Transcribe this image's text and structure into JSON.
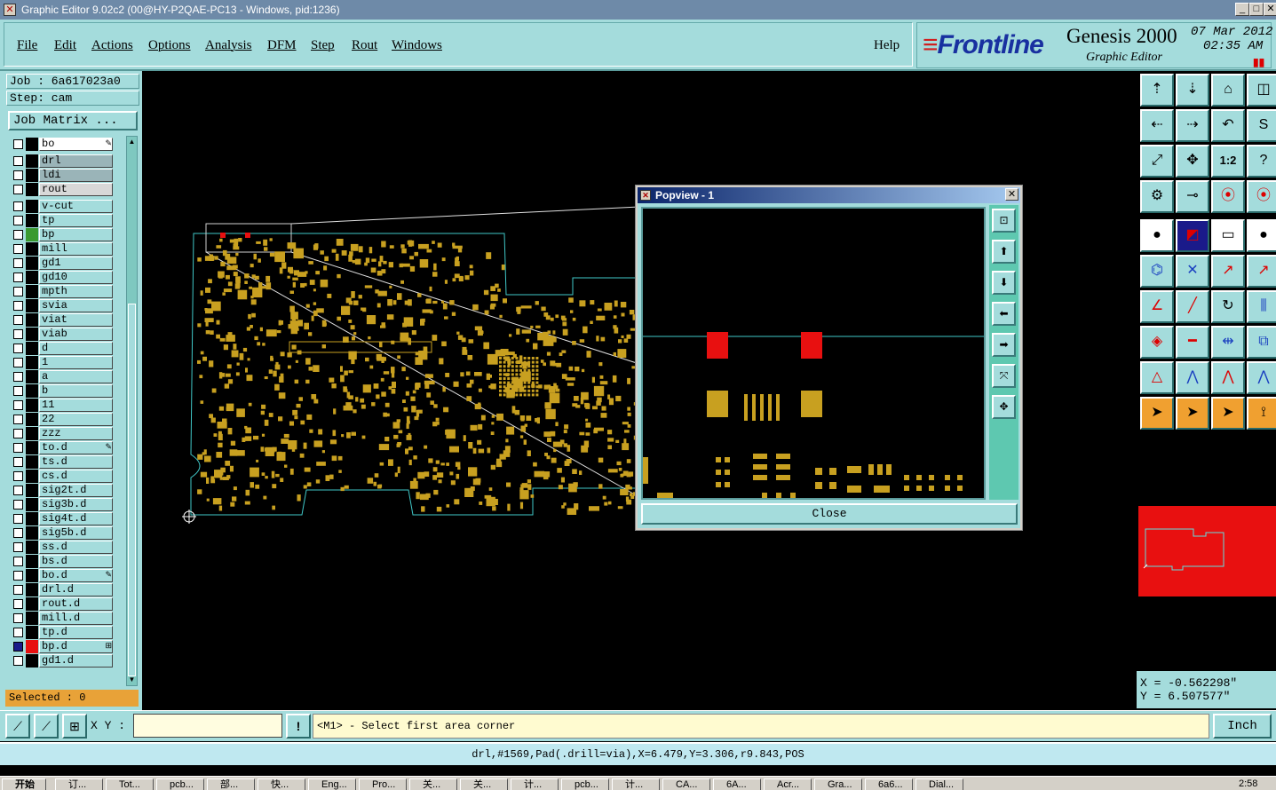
{
  "window": {
    "title": "Graphic Editor 9.02c2 (00@HY-P2QAE-PC13 - Windows, pid:1236)"
  },
  "menu": {
    "items": [
      "File",
      "Edit",
      "Actions",
      "Options",
      "Analysis",
      "DFM",
      "Step",
      "Rout",
      "Windows"
    ],
    "help": "Help"
  },
  "brand": {
    "logo": "Frontline",
    "product": "Genesis 2000",
    "subtitle": "Graphic Editor",
    "date": "07 Mar 2012",
    "time": "02:35 AM"
  },
  "job": {
    "job_label": "Job : 6a617023a0",
    "step_label": "Step: cam",
    "matrix_button": "Job Matrix ..."
  },
  "layers": [
    {
      "name": "bo",
      "color": "#000000",
      "mark": "✎",
      "style": "white"
    },
    {
      "name": "drl",
      "color": "#000000",
      "mark": "",
      "style": "grey"
    },
    {
      "name": "ldi",
      "color": "#000000",
      "mark": "",
      "style": "grey"
    },
    {
      "name": "rout",
      "color": "#000000",
      "mark": "",
      "style": "lightgrey"
    },
    {
      "name": "v-cut",
      "color": "#000000",
      "mark": "",
      "style": "normal"
    },
    {
      "name": "tp",
      "color": "#000000",
      "mark": "",
      "style": "normal"
    },
    {
      "name": "bp",
      "color": "#3a9a30",
      "mark": "",
      "style": "normal"
    },
    {
      "name": "mill",
      "color": "#000000",
      "mark": "",
      "style": "normal"
    },
    {
      "name": "gd1",
      "color": "#000000",
      "mark": "",
      "style": "normal"
    },
    {
      "name": "gd10",
      "color": "#000000",
      "mark": "",
      "style": "normal"
    },
    {
      "name": "mpth",
      "color": "#000000",
      "mark": "",
      "style": "normal"
    },
    {
      "name": "svia",
      "color": "#000000",
      "mark": "",
      "style": "normal"
    },
    {
      "name": "viat",
      "color": "#000000",
      "mark": "",
      "style": "normal"
    },
    {
      "name": "viab",
      "color": "#000000",
      "mark": "",
      "style": "normal"
    },
    {
      "name": "d",
      "color": "#000000",
      "mark": "",
      "style": "normal"
    },
    {
      "name": "1",
      "color": "#000000",
      "mark": "",
      "style": "normal"
    },
    {
      "name": "a",
      "color": "#000000",
      "mark": "",
      "style": "normal"
    },
    {
      "name": "b",
      "color": "#000000",
      "mark": "",
      "style": "normal"
    },
    {
      "name": "11",
      "color": "#000000",
      "mark": "",
      "style": "normal"
    },
    {
      "name": "22",
      "color": "#000000",
      "mark": "",
      "style": "normal"
    },
    {
      "name": "zzz",
      "color": "#000000",
      "mark": "",
      "style": "normal"
    },
    {
      "name": "to.d",
      "color": "#000000",
      "mark": "✎",
      "style": "normal"
    },
    {
      "name": "ts.d",
      "color": "#000000",
      "mark": "",
      "style": "normal"
    },
    {
      "name": "cs.d",
      "color": "#000000",
      "mark": "",
      "style": "normal"
    },
    {
      "name": "sig2t.d",
      "color": "#000000",
      "mark": "",
      "style": "normal"
    },
    {
      "name": "sig3b.d",
      "color": "#000000",
      "mark": "",
      "style": "normal"
    },
    {
      "name": "sig4t.d",
      "color": "#000000",
      "mark": "",
      "style": "normal"
    },
    {
      "name": "sig5b.d",
      "color": "#000000",
      "mark": "",
      "style": "normal"
    },
    {
      "name": "ss.d",
      "color": "#000000",
      "mark": "",
      "style": "normal"
    },
    {
      "name": "bs.d",
      "color": "#000000",
      "mark": "",
      "style": "normal"
    },
    {
      "name": "bo.d",
      "color": "#000000",
      "mark": "✎",
      "style": "normal"
    },
    {
      "name": "drl.d",
      "color": "#000000",
      "mark": "",
      "style": "normal"
    },
    {
      "name": "rout.d",
      "color": "#000000",
      "mark": "",
      "style": "normal"
    },
    {
      "name": "mill.d",
      "color": "#000000",
      "mark": "",
      "style": "normal"
    },
    {
      "name": "tp.d",
      "color": "#000000",
      "mark": "",
      "style": "normal"
    },
    {
      "name": "bp.d",
      "color": "#e81010",
      "mark": "⊞",
      "style": "normal"
    },
    {
      "name": "gd1.d",
      "color": "#000000",
      "mark": "",
      "style": "normal"
    }
  ],
  "selected": "Selected : 0",
  "popview": {
    "title": "Popview - 1",
    "close_label": "Close"
  },
  "coords": {
    "x": "X = -0.562298\"",
    "y": "Y = 6.507577\""
  },
  "command": {
    "xy_label": "X Y :",
    "xy_value": "",
    "prompt": "<M1> - Select first area corner",
    "unit": "Inch"
  },
  "status": "drl,#1569,Pad(.drill=via),X=6.479,Y=3.306,r9.843,POS",
  "taskbar": {
    "start": "开始",
    "tasks": [
      "订...",
      "Tot...",
      "pcb...",
      "部...",
      "快...",
      "Eng...",
      "Pro...",
      "关...",
      "关...",
      "计...",
      "pcb...",
      "计...",
      "CA...",
      "6A...",
      "Acr...",
      "Gra...",
      "6a6...",
      "Dial..."
    ],
    "clock": "2:58"
  },
  "colors": {
    "panel": "#a4dcdc",
    "pad": "#c8a020",
    "outline": "#40c8c8",
    "highlight": "#e81010"
  }
}
